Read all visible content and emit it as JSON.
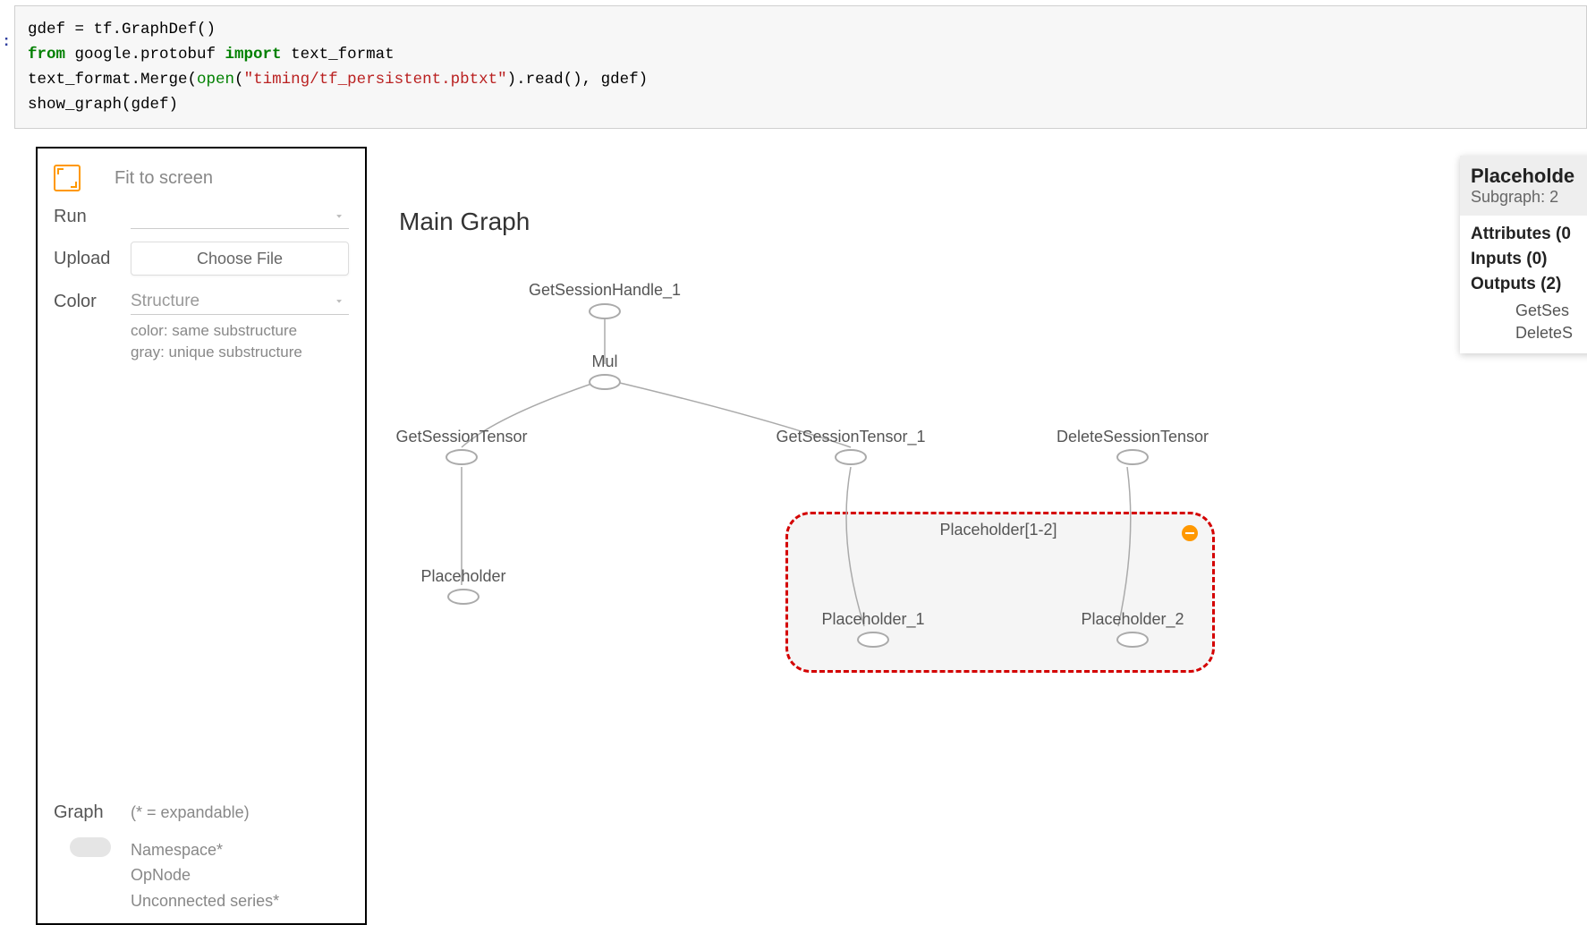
{
  "code": {
    "l1_a": "gdef = tf.GraphDef()",
    "l2_kw1": "from",
    "l2_mid": " google.protobuf ",
    "l2_kw2": "import",
    "l2_end": " text_format",
    "l3_a": "text_format.Merge(",
    "l3_fn": "open",
    "l3_p1": "(",
    "l3_str": "\"timing/tf_persistent.pbtxt\"",
    "l3_b": ").read(), gdef)",
    "l4_a": "show_graph(gdef)"
  },
  "sidebar": {
    "fit_label": "Fit to screen",
    "run_label": "Run",
    "upload_label": "Upload",
    "choose_file": "Choose File",
    "color_label": "Color",
    "color_value": "Structure",
    "color_hint1": "color: same substructure",
    "color_hint2": "gray: unique substructure",
    "graph_label": "Graph",
    "graph_hint": "(* = expandable)",
    "legend_namespace": "Namespace*",
    "legend_opnode": "OpNode",
    "legend_unconnected": "Unconnected series*"
  },
  "graph": {
    "title": "Main Graph",
    "nodes": {
      "gsh1": "GetSessionHandle_1",
      "mul": "Mul",
      "gst": "GetSessionTensor",
      "gst1": "GetSessionTensor_1",
      "dst": "DeleteSessionTensor",
      "ph": "Placeholder",
      "group": "Placeholder[1-2]",
      "ph1": "Placeholder_1",
      "ph2": "Placeholder_2"
    }
  },
  "info": {
    "title": "Placeholde",
    "subgraph": "Subgraph: 2",
    "attributes": "Attributes (0",
    "inputs": "Inputs (0)",
    "outputs": "Outputs (2)",
    "out1": "GetSes",
    "out2": "DeleteS"
  }
}
